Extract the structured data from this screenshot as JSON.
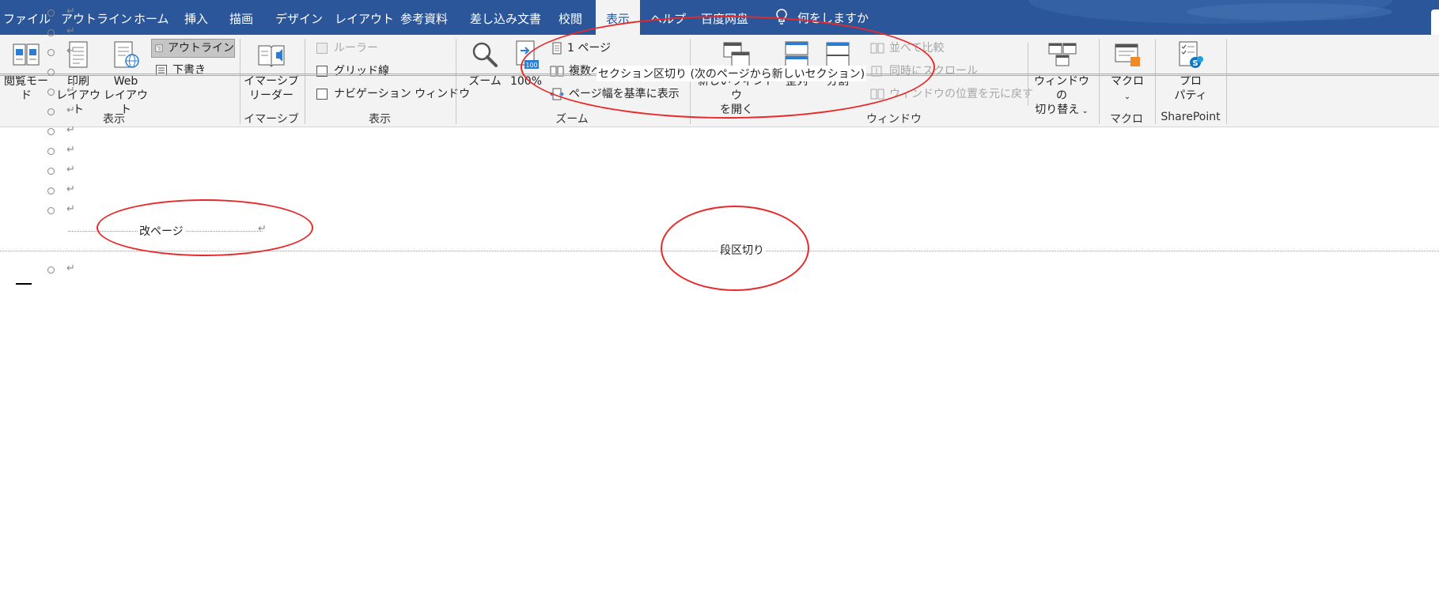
{
  "tabs": {
    "file": "ファイル",
    "outline": "アウトライン",
    "home": "ホーム",
    "insert": "挿入",
    "draw": "描画",
    "design": "デザイン",
    "layout": "レイアウト",
    "references": "参考資料",
    "mailings": "差し込み文書",
    "review": "校閲",
    "view": "表示",
    "help": "ヘルプ",
    "baidu": "百度网盘",
    "tell_me": "何をしますか"
  },
  "ribbon": {
    "views": {
      "read_mode": "閲覧モード",
      "print_layout_1": "印刷",
      "print_layout_2": "レイアウト",
      "web_layout_1": "Web",
      "web_layout_2": "レイアウト",
      "outline": "アウトライン",
      "draft": "下書き",
      "group": "表示"
    },
    "immersive": {
      "reader_1": "イマーシブ",
      "reader_2": "リーダー",
      "group": "イマーシブ"
    },
    "show": {
      "ruler": "ルーラー",
      "gridlines": "グリッド線",
      "navigation": "ナビゲーション ウィンドウ",
      "group": "表示"
    },
    "zoom": {
      "zoom": "ズーム",
      "hundred": "100%",
      "hundred_icon": "100",
      "one_page": "1 ページ",
      "multiple_pages": "複数ページ",
      "page_width": "ページ幅を基準に表示",
      "group": "ズーム"
    },
    "window": {
      "new_window_1": "新しいウィンドウ",
      "new_window_2": "を開く",
      "arrange": "整列",
      "split": "分割",
      "side_by_side": "並べて比較",
      "sync_scroll": "同時にスクロール",
      "reset_position": "ウィンドウの位置を元に戻す",
      "switch_1": "ウィンドウの",
      "switch_2": "切り替え",
      "group": "ウィンドウ"
    },
    "macros": {
      "macros": "マクロ",
      "group": "マクロ"
    },
    "sharepoint": {
      "properties_1": "プロ",
      "properties_2": "パティ",
      "group": "SharePoint"
    }
  },
  "document": {
    "paragraph_mark": "↵",
    "section_break": "セクション区切り (次のページから新しいセクション)",
    "page_break": "改ページ",
    "column_break": "段区切り"
  },
  "colors": {
    "tab_bar": "#2b579a",
    "ribbon_bg": "#f3f3f3",
    "annotation": "#e8292a"
  }
}
